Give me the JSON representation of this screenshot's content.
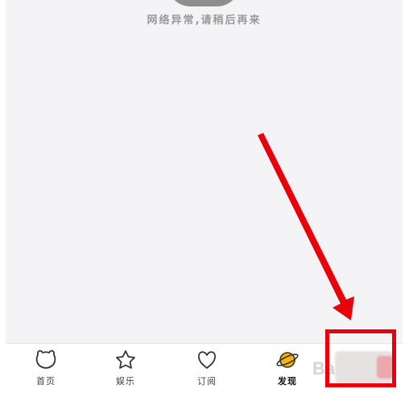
{
  "status": {
    "error_message": "网络异常,请稍后再来"
  },
  "tabs": [
    {
      "label": "首页",
      "icon": "cat-face-icon",
      "active": false
    },
    {
      "label": "娱乐",
      "icon": "star-icon",
      "active": false
    },
    {
      "label": "订阅",
      "icon": "heart-icon",
      "active": false
    },
    {
      "label": "发现",
      "icon": "planet-icon",
      "active": true
    }
  ],
  "watermark": "Bai",
  "colors": {
    "background": "#f4f4f6",
    "annotation_red": "#e8000a",
    "planet_yellow": "#f7b500",
    "icon_stroke": "#333333"
  }
}
